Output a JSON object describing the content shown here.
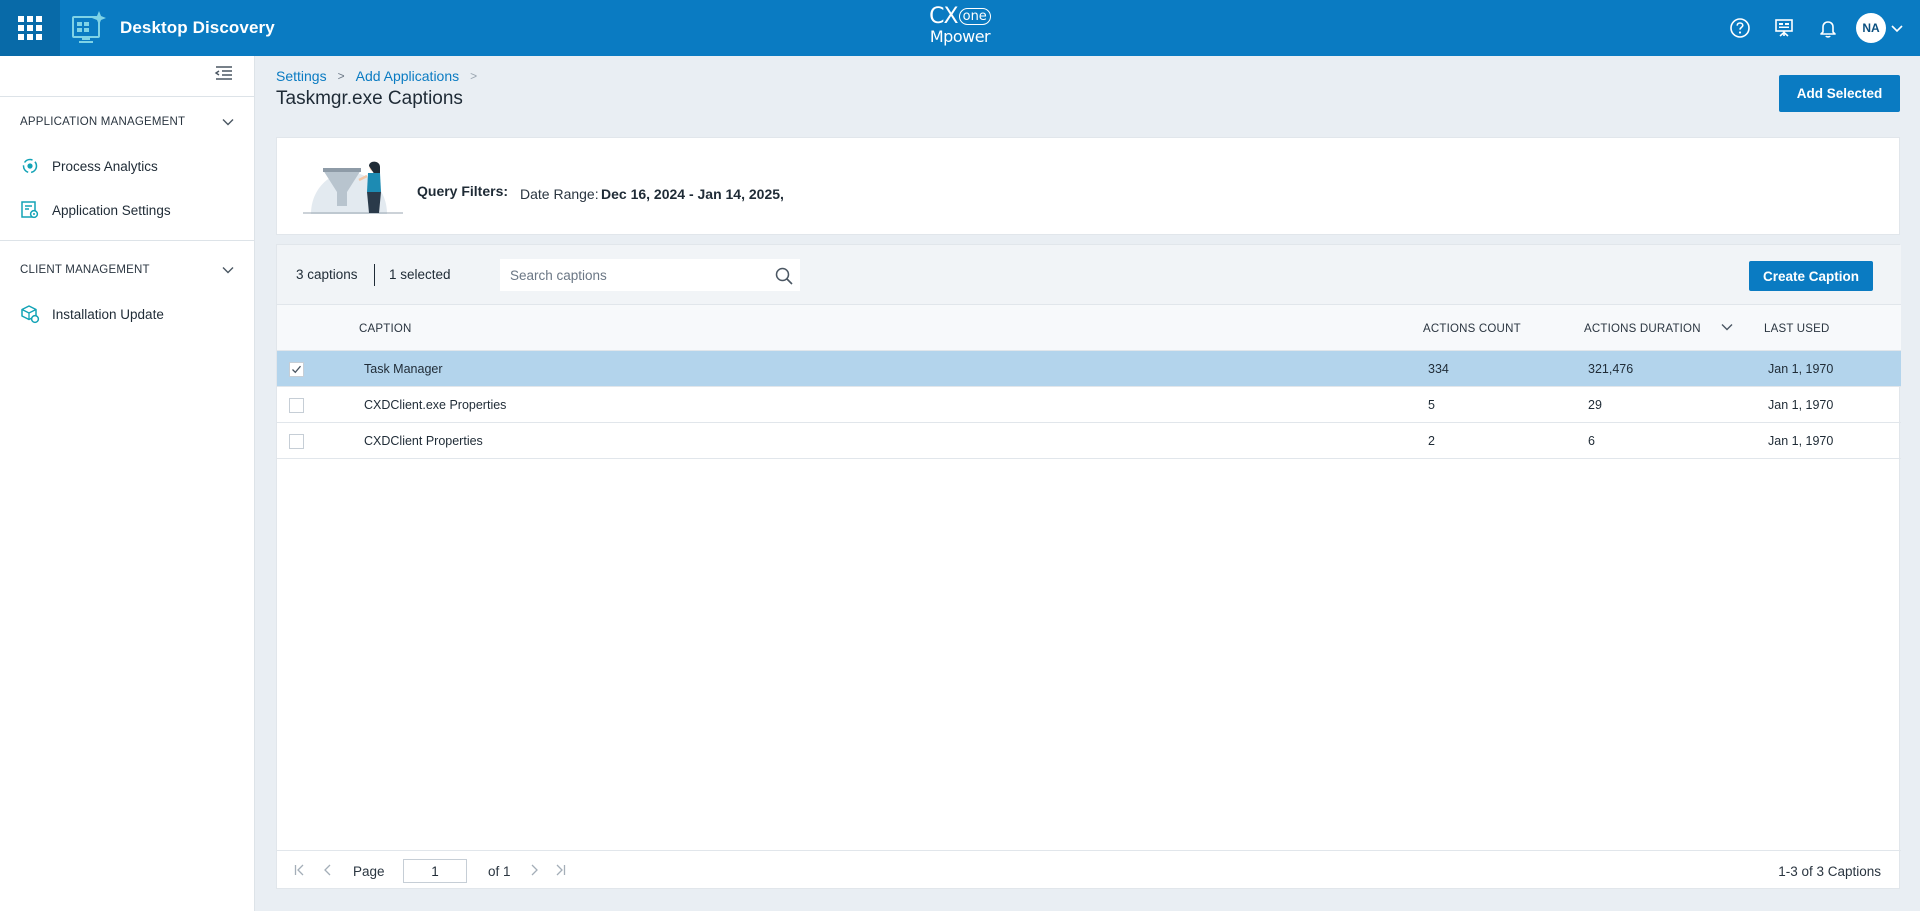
{
  "header": {
    "product_name": "Desktop Discovery",
    "brand_line1": "CX",
    "brand_one": "one",
    "brand_line2": "Mpower",
    "avatar_initials": "NA",
    "accent_color": "#0a7bc2"
  },
  "sidebar": {
    "sections": [
      {
        "label": "APPLICATION MANAGEMENT",
        "items": [
          {
            "label": "Process Analytics",
            "icon": "process-analytics-icon"
          },
          {
            "label": "Application Settings",
            "icon": "application-settings-icon"
          }
        ]
      },
      {
        "label": "CLIENT MANAGEMENT",
        "items": [
          {
            "label": "Installation Update",
            "icon": "installation-update-icon"
          }
        ]
      }
    ]
  },
  "breadcrumb": {
    "items": [
      "Settings",
      "Add Applications"
    ],
    "separator": ">"
  },
  "page": {
    "title": "Taskmgr.exe Captions",
    "add_selected_label": "Add Selected"
  },
  "filters": {
    "label": "Query Filters:",
    "date_range_label": "Date Range:",
    "date_range_value": "Dec 16, 2024 - Jan 14, 2025,"
  },
  "table": {
    "count_text": "3 captions",
    "selected_text": "1 selected",
    "search_placeholder": "Search captions",
    "create_label": "Create Caption",
    "columns": [
      "CAPTION",
      "ACTIONS COUNT",
      "ACTIONS DURATION",
      "LAST USED"
    ],
    "rows": [
      {
        "caption": "Task Manager",
        "actions_count": "334",
        "actions_duration": "321,476",
        "last_used": "Jan 1, 1970",
        "selected": true
      },
      {
        "caption": "CXDClient.exe Properties",
        "actions_count": "5",
        "actions_duration": "29",
        "last_used": "Jan 1, 1970",
        "selected": false
      },
      {
        "caption": "CXDClient Properties",
        "actions_count": "2",
        "actions_duration": "6",
        "last_used": "Jan 1, 1970",
        "selected": false
      }
    ]
  },
  "pager": {
    "page_label": "Page",
    "page_value": "1",
    "of_label": "of 1",
    "summary": "1-3 of 3 Captions"
  }
}
